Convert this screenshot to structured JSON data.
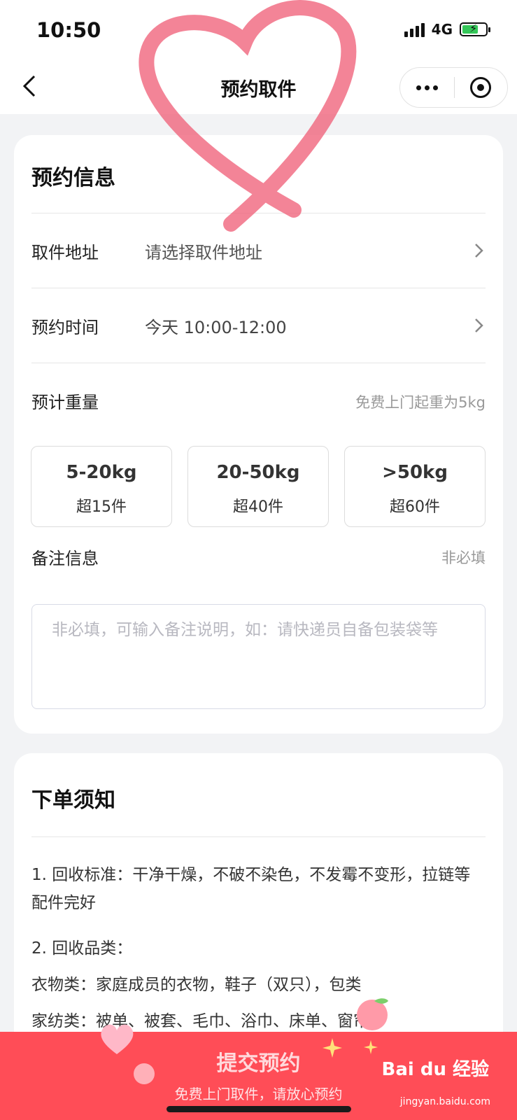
{
  "status": {
    "time": "10:50",
    "network": "4G"
  },
  "nav": {
    "title": "预约取件"
  },
  "booking": {
    "title": "预约信息",
    "address": {
      "label": "取件地址",
      "placeholder": "请选择取件地址"
    },
    "time": {
      "label": "预约时间",
      "value": "今天 10:00-12:00"
    },
    "weight": {
      "label": "预计重量",
      "hint": "免费上门起重为5kg",
      "options": [
        {
          "range": "5-20kg",
          "pieces": "超15件"
        },
        {
          "range": "20-50kg",
          "pieces": "超40件"
        },
        {
          "range": ">50kg",
          "pieces": "超60件"
        }
      ]
    },
    "remark": {
      "label": "备注信息",
      "hint": "非必填",
      "placeholder": "非必填，可输入备注说明，如：请快递员自备包装袋等"
    }
  },
  "notice": {
    "title": "下单须知",
    "items": [
      "1. 回收标准：干净干燥，不破不染色，不发霉不变形，拉链等配件完好",
      "2. 回收品类：",
      "衣物类：家庭成员的衣物，鞋子（双只），包类",
      "家纺类：被单、被套、毛巾、浴巾、床单、窗帘"
    ]
  },
  "footer": {
    "submit_label": "提交预约",
    "submit_sub": "免费上门取件，请放心预约",
    "watermark": "Bai du 经验",
    "watermark_url": "jingyan.baidu.com"
  },
  "icons": [
    "back-icon",
    "more-icon",
    "close-mini-program-icon",
    "chevron-right-icon",
    "heart-sticker",
    "peach-sticker",
    "sparkle-sticker"
  ],
  "colors": {
    "accent": "#ff4d57",
    "battery": "#35c759",
    "heart": "#f0627a"
  }
}
